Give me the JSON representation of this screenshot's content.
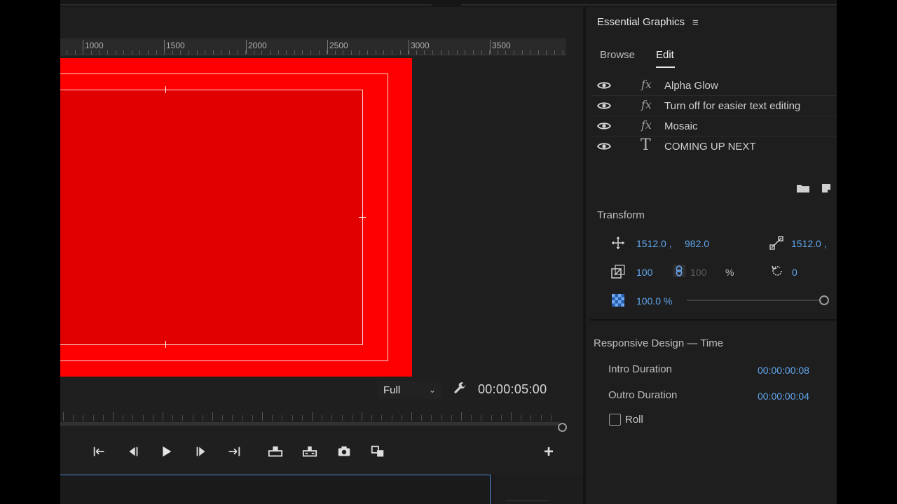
{
  "ruler": {
    "labels": [
      "1000",
      "1500",
      "2000",
      "2500",
      "3000",
      "3500"
    ]
  },
  "program": {
    "resolution": "Full",
    "timecode": "00:00:05:00"
  },
  "transport_icons": [
    "go-to-in-icon",
    "step-back-icon",
    "play-icon",
    "step-forward-icon",
    "go-to-out-icon",
    "lift-icon",
    "extract-icon",
    "export-frame-icon",
    "compare-icon"
  ],
  "panel": {
    "title": "Essential Graphics",
    "menu_glyph": "≡",
    "tabs": {
      "browse": "Browse",
      "edit": "Edit"
    },
    "layers": [
      {
        "kind": "fx",
        "glyph": "fx",
        "name": "Alpha Glow"
      },
      {
        "kind": "fx",
        "glyph": "fx",
        "name": "Turn off for easier text editing"
      },
      {
        "kind": "fx",
        "glyph": "fx",
        "name": "Mosaic"
      },
      {
        "kind": "text",
        "glyph": "T",
        "name": "COMING UP NEXT"
      }
    ],
    "transform": {
      "title": "Transform",
      "position_x": "1512.0 ,",
      "position_y": "982.0",
      "anchor_x": "1512.0 ,",
      "scale": "100",
      "scale_linked": "100",
      "scale_unit": "%",
      "rotation": "0",
      "opacity": "100.0 %",
      "opacity_fraction": 1.0
    },
    "responsive": {
      "title": "Responsive Design — Time",
      "intro_label": "Intro Duration",
      "intro_value": "00:00:00:08",
      "outro_label": "Outro Duration",
      "outro_value": "00:00:00:04",
      "roll_label": "Roll",
      "roll_checked": false
    }
  },
  "colors": {
    "accent_blue": "#62a8f0",
    "canvas_red": "#ff0000",
    "inner_red": "#e00000",
    "panel_bg": "#1e1e1e"
  }
}
